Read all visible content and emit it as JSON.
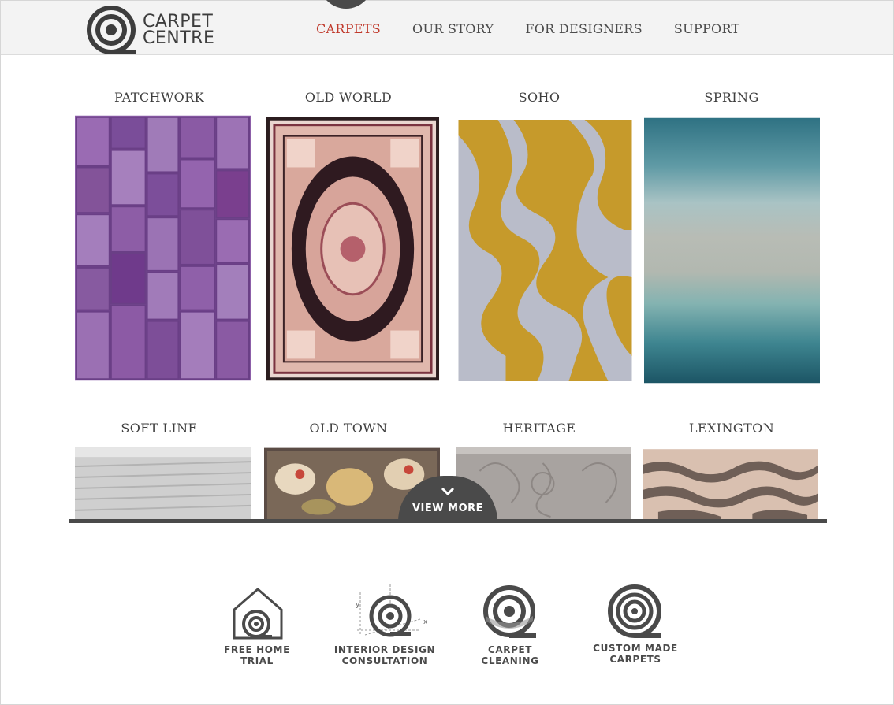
{
  "brand": {
    "line1": "CARPET",
    "line2": "CENTRE"
  },
  "nav": [
    {
      "label": "CARPETS",
      "active": true
    },
    {
      "label": "OUR STORY",
      "active": false
    },
    {
      "label": "FOR DESIGNERS",
      "active": false
    },
    {
      "label": "SUPPORT",
      "active": false
    }
  ],
  "carpets": [
    {
      "name": "PATCHWORK"
    },
    {
      "name": "OLD WORLD"
    },
    {
      "name": "SOHO"
    },
    {
      "name": "SPRING"
    },
    {
      "name": "SOFT LINE"
    },
    {
      "name": "OLD TOWN"
    },
    {
      "name": "HERITAGE"
    },
    {
      "name": "LEXINGTON"
    }
  ],
  "view_more": {
    "label": "VIEW MORE",
    "icon": "chevron-down-icon"
  },
  "services": [
    {
      "line1": "FREE HOME",
      "line2": "TRIAL",
      "icon": "house-icon"
    },
    {
      "line1": "INTERIOR DESIGN",
      "line2": "CONSULTATION",
      "icon": "design-axes-icon"
    },
    {
      "line1": "CARPET",
      "line2": "CLEANING",
      "icon": "cleaning-roll-icon"
    },
    {
      "line1": "CUSTOM MADE",
      "line2": "CARPETS",
      "icon": "carpet-roll-icon"
    }
  ],
  "colors": {
    "accent": "#c0392b",
    "dark": "#4a4a4a",
    "header_bg": "#f3f3f3"
  }
}
